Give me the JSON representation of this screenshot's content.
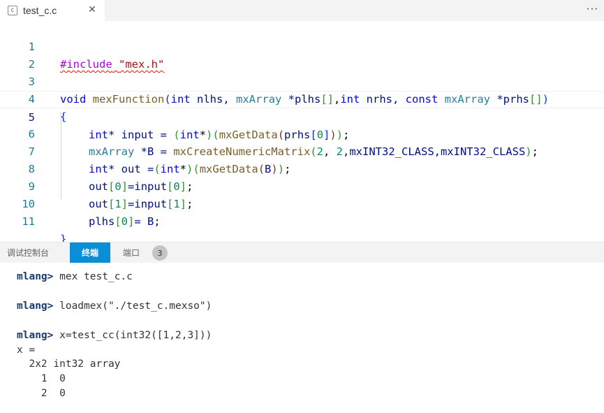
{
  "tab": {
    "icon_glyph": "c",
    "title": "test_c.c",
    "close_glyph": "✕",
    "more_glyph": "···"
  },
  "editor": {
    "line_numbers": [
      "1",
      "2",
      "3",
      "4",
      "5",
      "6",
      "7",
      "8",
      "9",
      "10",
      "11"
    ],
    "current_line": 5,
    "code": {
      "l1_directive": "#include",
      "l1_header": "\"mex.h\"",
      "l3_void": "void",
      "l3_fn": "mexFunction",
      "l3_open": "(",
      "l3_int1": "int",
      "l3_nlhs": " nlhs, ",
      "l3_mxArray1": "mxArray",
      "l3_plhs": " *plhs",
      "l3_br": "[]",
      "l3_comma": ",",
      "l3_int2": "int",
      "l3_nrhs": " nrhs, ",
      "l3_const": "const",
      "l3_mxArray2": " mxArray ",
      "l3_prhs": "*prhs",
      "l3_br2": "[]",
      "l3_close": ")",
      "l4": "{",
      "l5_int": "int",
      "l5_a": "* input = ",
      "l5_p1": "(",
      "l5_int2": "int",
      "l5_b": "*",
      "l5_p1c": ")",
      "l5_p2": "(",
      "l5_fn": "mxGetData",
      "l5_p3": "(",
      "l5_prhs": "prhs",
      "l5_br": "[",
      "l5_zero": "0",
      "l5_brc": "]",
      "l5_p3c": ")",
      "l5_p2c": ")",
      "l5_end": ";",
      "l6_type": "mxArray",
      "l6_a": " *B = ",
      "l6_fn": "mxCreateNumericMatrix",
      "l6_p": "(",
      "l6_n1": "2",
      "l6_c1": ", ",
      "l6_n2": "2",
      "l6_rest": ",mxINT32_CLASS,mxINT32_CLASS",
      "l6_pc": ")",
      "l6_end": ";",
      "l7_int": "int",
      "l7_a": "* out =",
      "l7_p1": "(",
      "l7_int2": "int",
      "l7_b": "*",
      "l7_p1c": ")",
      "l7_p2": "(",
      "l7_fn": "mxGetData",
      "l7_p3": "(",
      "l7_B": "B",
      "l7_p3c": ")",
      "l7_p2c": ")",
      "l7_end": ";",
      "l8_a": "out",
      "l8_br": "[",
      "l8_n": "0",
      "l8_brc": "]",
      "l8_b": "=input",
      "l8_br2": "[",
      "l8_n2": "0",
      "l8_brc2": "]",
      "l8_end": ";",
      "l9_a": "out",
      "l9_br": "[",
      "l9_n": "1",
      "l9_brc": "]",
      "l9_b": "=input",
      "l9_br2": "[",
      "l9_n2": "1",
      "l9_brc2": "]",
      "l9_end": ";",
      "l10_a": "plhs",
      "l10_br": "[",
      "l10_n": "0",
      "l10_brc": "]",
      "l10_b": "= B;",
      "l11": "}"
    }
  },
  "panel": {
    "tabs": [
      "调试控制台",
      "终端",
      "端口"
    ],
    "active_tab": "终端",
    "ports_badge": "3"
  },
  "terminal": {
    "prompt": "mlang>",
    "cmd1": " mex test_c.c",
    "cmd2": " loadmex(\"./test_c.mexso\")",
    "cmd3": " x=test_cc(int32([1,2,3]))",
    "out1": "x =",
    "out2": "  2x2 int32 array",
    "out3": "    1  0",
    "out4": "    2  0"
  },
  "colors": {
    "accent_tab": "#0a8fd6",
    "line_number": "#237893",
    "keyword": "#0000ff",
    "error_squiggle": "#e51400"
  }
}
